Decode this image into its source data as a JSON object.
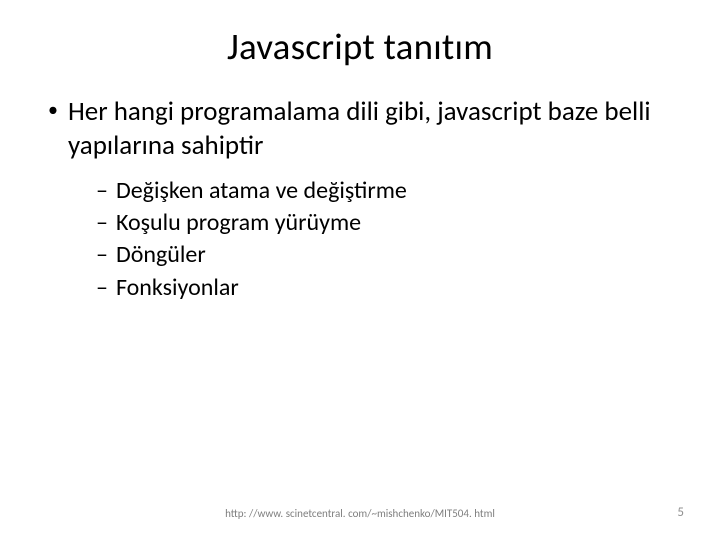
{
  "title": "Javascript tanıtım",
  "bullets": {
    "main": "Her hangi programalama dili gibi, javascript baze belli yapılarına sahiptir",
    "subs": [
      "Değişken atama ve değiştirme",
      "Koşulu program yürüyme",
      "Döngüler",
      "Fonksiyonlar"
    ]
  },
  "footer_url": "http: //www. scinetcentral. com/~mishchenko/MIT504. html",
  "page_number": "5"
}
